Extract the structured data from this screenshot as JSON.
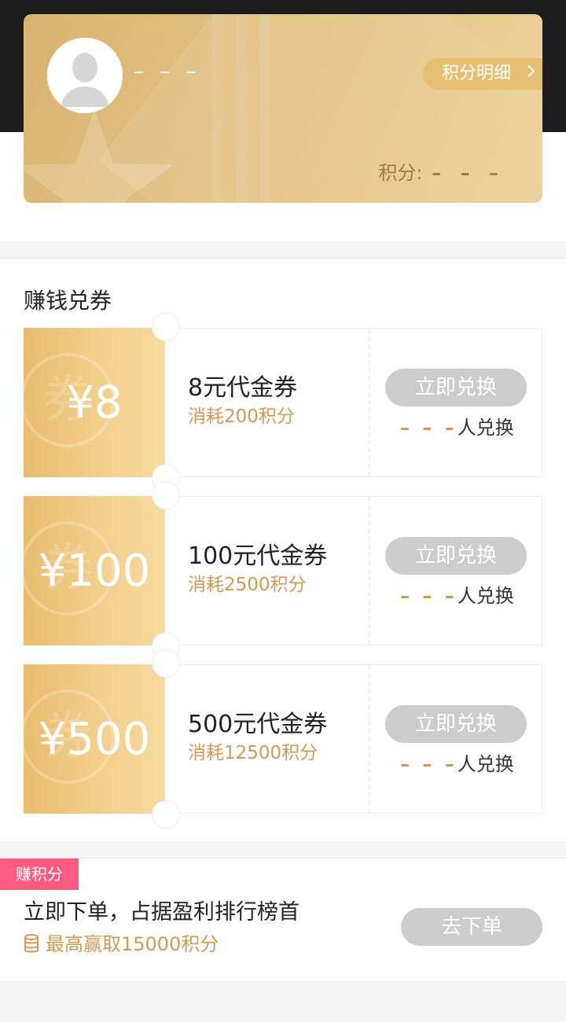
{
  "header": {
    "user_name": "– – –",
    "points_detail_label": "积分明细",
    "points_label": "积分:",
    "points_value": "– – –",
    "icons": {
      "avatar": "user-avatar-icon",
      "chevron": "chevron-right-icon"
    },
    "card_colors": {
      "start": "#d9b36f",
      "end": "#ecd39e"
    }
  },
  "coupons_section": {
    "title": "赚钱兑券",
    "watermark_char": "券",
    "items": [
      {
        "amount": "¥8",
        "name": "8元代金券",
        "cost": "消耗200积分",
        "button": "立即兑换",
        "count_placeholder": "– – –",
        "count_suffix": "人兑换"
      },
      {
        "amount": "¥100",
        "name": "100元代金券",
        "cost": "消耗2500积分",
        "button": "立即兑换",
        "count_placeholder": "– – –",
        "count_suffix": "人兑换"
      },
      {
        "amount": "¥500",
        "name": "500元代金券",
        "cost": "消耗12500积分",
        "button": "立即兑换",
        "count_placeholder": "– – –",
        "count_suffix": "人兑换"
      }
    ]
  },
  "earn_section": {
    "tag": "赚积分",
    "text": "立即下单，占据盈利排行榜首",
    "reward": "最高赢取15000积分",
    "button": "去下单",
    "icons": {
      "reward": "coin-stack-icon"
    },
    "tag_color": "#ff5a7f"
  },
  "colors": {
    "accent_gold": "#d09a55",
    "disabled_button": "#cccccc"
  }
}
